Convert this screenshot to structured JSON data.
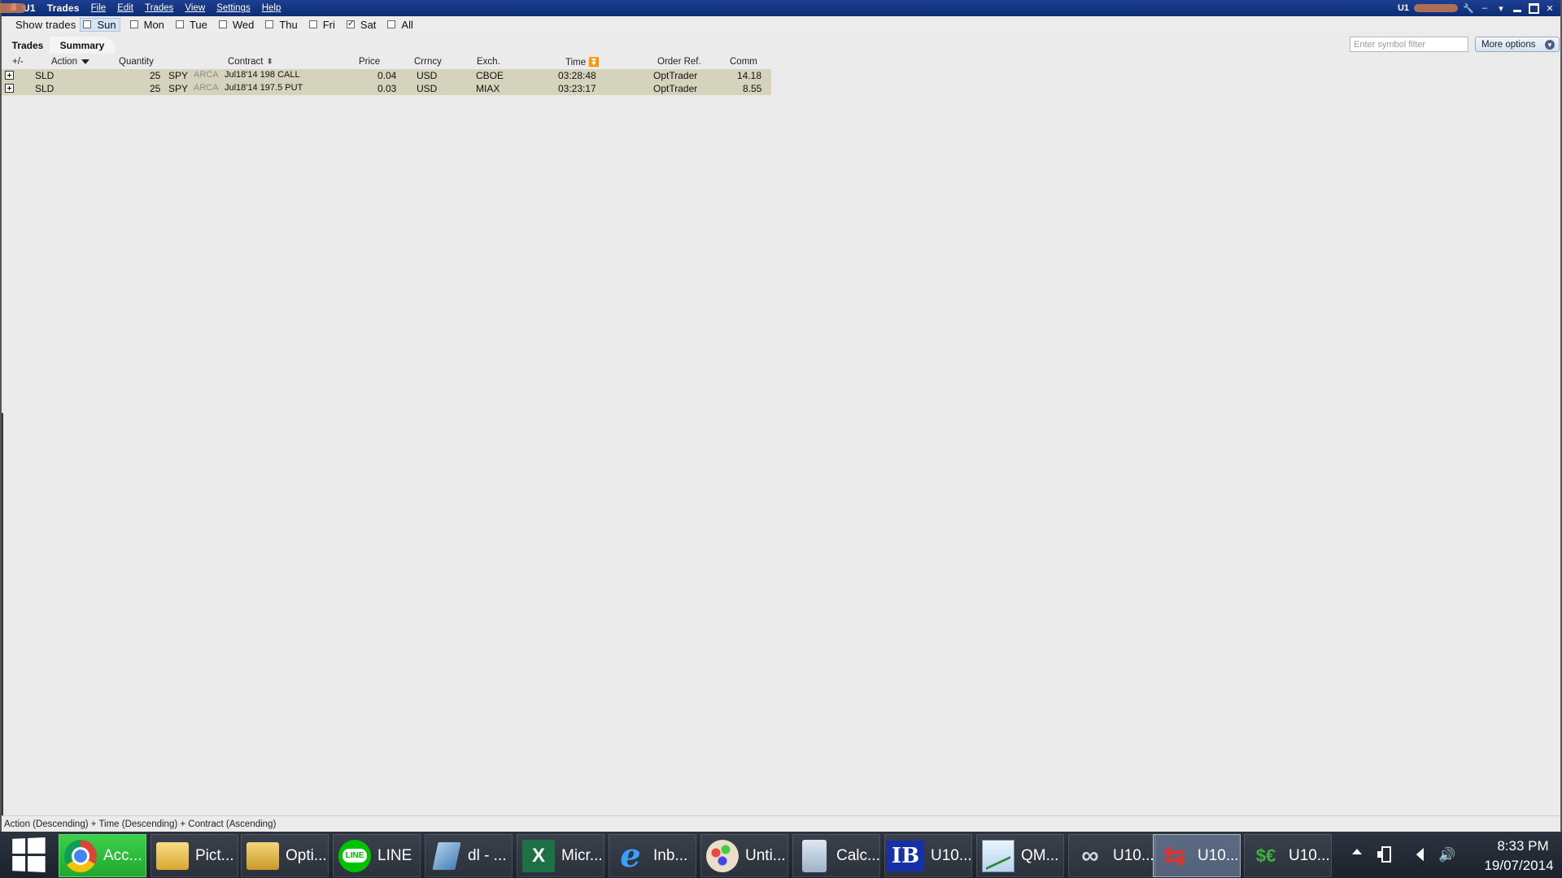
{
  "window": {
    "title_prefix": "U1",
    "title": "Trades",
    "menu": [
      "File",
      "Edit",
      "Trades",
      "View",
      "Settings",
      "Help"
    ],
    "right_label": "U1"
  },
  "show_trades": {
    "label": "Show trades",
    "days": [
      {
        "label": "Sun",
        "checked": false,
        "active": true
      },
      {
        "label": "Mon",
        "checked": false
      },
      {
        "label": "Tue",
        "checked": false
      },
      {
        "label": "Wed",
        "checked": false
      },
      {
        "label": "Thu",
        "checked": false
      },
      {
        "label": "Fri",
        "checked": false
      },
      {
        "label": "Sat",
        "checked": true
      },
      {
        "label": "All",
        "checked": false
      }
    ]
  },
  "tabs": {
    "trades": "Trades",
    "summary": "Summary"
  },
  "filter": {
    "placeholder": "Enter symbol filter",
    "value": ""
  },
  "more_options": "More options",
  "table": {
    "headers": {
      "expand": "+/-",
      "action": "Action",
      "quantity": "Quantity",
      "contract": "Contract",
      "price": "Price",
      "currency": "Crrncy",
      "exchange": "Exch.",
      "time": "Time",
      "order_ref": "Order Ref.",
      "comm": "Comm"
    },
    "rows": [
      {
        "action": "SLD",
        "quantity": "25",
        "symbol": "SPY",
        "exch_tag": "ARCA",
        "contract": "Jul18'14 198 CALL",
        "price": "0.04",
        "currency": "USD",
        "exchange": "CBOE",
        "time": "03:28:48",
        "order_ref": "OptTrader",
        "comm": "14.18"
      },
      {
        "action": "SLD",
        "quantity": "25",
        "symbol": "SPY",
        "exch_tag": "ARCA",
        "contract": "Jul18'14 197.5 PUT",
        "price": "0.03",
        "currency": "USD",
        "exchange": "MIAX",
        "time": "03:23:17",
        "order_ref": "OptTrader",
        "comm": "8.55"
      }
    ]
  },
  "status_bar": "Action (Descending)  +  Time (Descending)  +  Contract (Ascending)",
  "taskbar": {
    "items": [
      {
        "label": "Acc...",
        "icon": "chrome-icon"
      },
      {
        "label": "Pict...",
        "icon": "pictures-folder-icon"
      },
      {
        "label": "Opti...",
        "icon": "folder-icon"
      },
      {
        "label": "LINE",
        "icon": "line-icon"
      },
      {
        "label": "dl - ...",
        "icon": "notepad-icon"
      },
      {
        "label": "Micr...",
        "icon": "excel-icon"
      },
      {
        "label": "Inb...",
        "icon": "internet-explorer-icon"
      },
      {
        "label": "Unti...",
        "icon": "paint-icon"
      },
      {
        "label": "Calc...",
        "icon": "calculator-icon"
      },
      {
        "label": "U10...",
        "icon": "ib-icon"
      },
      {
        "label": "QM...",
        "icon": "chart-icon"
      },
      {
        "label": "U10...",
        "icon": "chain-icon"
      },
      {
        "label": "U10...",
        "icon": "arrows-icon"
      },
      {
        "label": "U10...",
        "icon": "currency-icon"
      }
    ],
    "clock": {
      "time": "8:33 PM",
      "date": "19/07/2014"
    }
  }
}
